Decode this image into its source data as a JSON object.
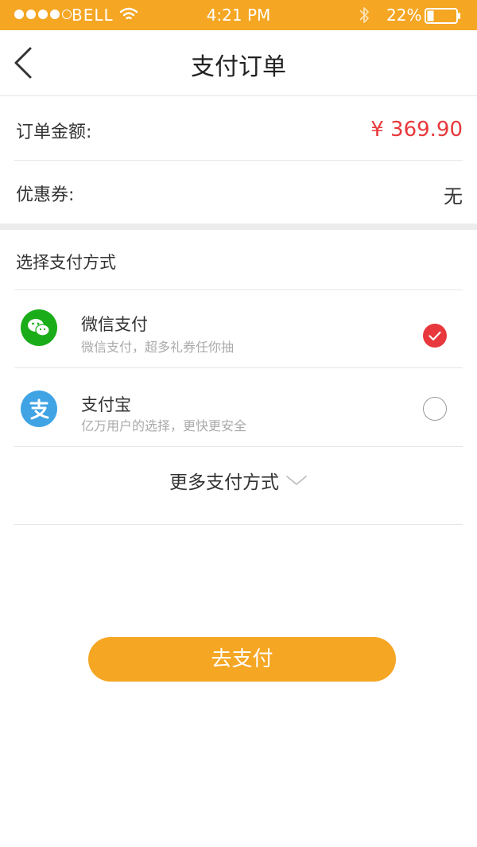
{
  "status_bar": {
    "carrier": "BELL",
    "time": "4:21 PM",
    "battery": "22%"
  },
  "nav": {
    "title": "支付订单"
  },
  "order": {
    "amount_label": "订单金额:",
    "amount_value": "¥ 369.90",
    "coupon_label": "优惠券:",
    "coupon_value": "无"
  },
  "payment": {
    "section_title": "选择支付方式",
    "methods": [
      {
        "name": "微信支付",
        "description": "微信支付，超多礼券任你抽",
        "icon": "wechat-icon",
        "selected": true
      },
      {
        "name": "支付宝",
        "description": "亿万用户的选择，更快更安全",
        "icon": "alipay-icon",
        "selected": false
      }
    ],
    "more_label": "更多支付方式"
  },
  "pay_button": {
    "label": "去支付"
  },
  "colors": {
    "accent": "#f5a623",
    "price": "#e8383d",
    "wechat": "#1aad19",
    "alipay": "#40a4e4"
  }
}
